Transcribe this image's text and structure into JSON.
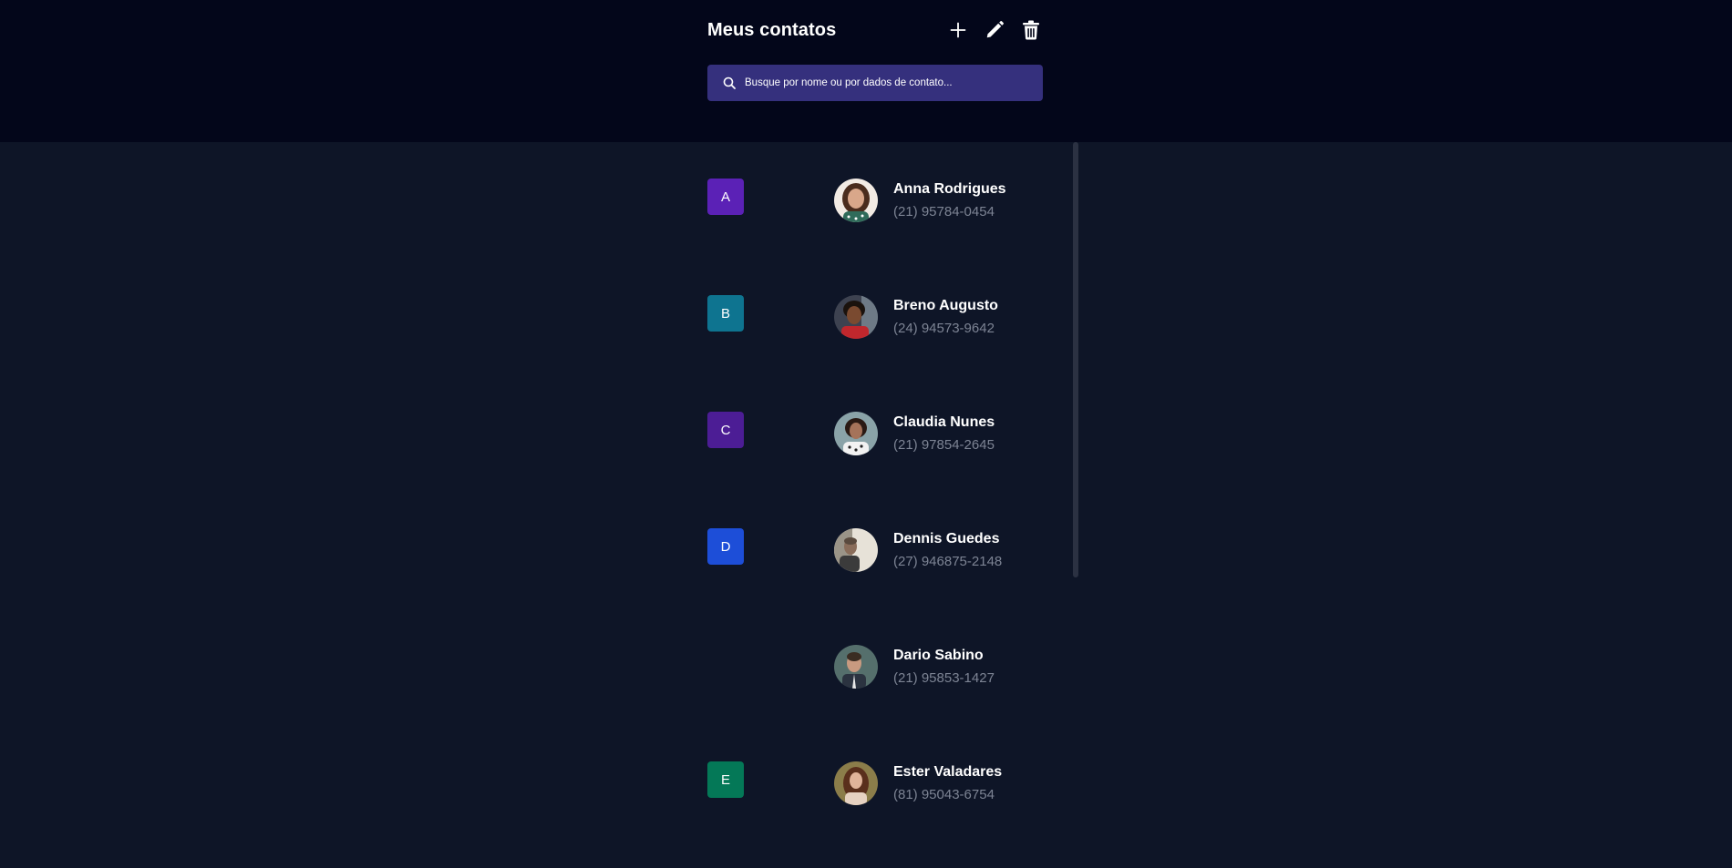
{
  "header": {
    "title": "Meus contatos",
    "actions": [
      {
        "name": "add",
        "icon": "plus-icon"
      },
      {
        "name": "edit",
        "icon": "pencil-icon"
      },
      {
        "name": "delete",
        "icon": "trash-icon"
      }
    ]
  },
  "search": {
    "placeholder": "Busque por nome ou por dados de contato...",
    "icon": "search-icon"
  },
  "groups": [
    {
      "letter": "A",
      "color": "#5b21b6",
      "contacts": [
        {
          "name": "Anna Rodrigues",
          "phone": "(21) 95784-0454"
        }
      ]
    },
    {
      "letter": "B",
      "color": "#0e7490",
      "contacts": [
        {
          "name": "Breno Augusto",
          "phone": "(24) 94573-9642"
        }
      ]
    },
    {
      "letter": "C",
      "color": "#4c1d95",
      "contacts": [
        {
          "name": "Claudia Nunes",
          "phone": "(21) 97854-2645"
        }
      ]
    },
    {
      "letter": "D",
      "color": "#1d4ed8",
      "contacts": [
        {
          "name": "Dennis Guedes",
          "phone": "(27) 946875-2148"
        },
        {
          "name": "Dario Sabino",
          "phone": "(21) 95853-1427"
        }
      ]
    },
    {
      "letter": "E",
      "color": "#047857",
      "contacts": [
        {
          "name": "Ester Valadares",
          "phone": "(81) 95043-6754"
        }
      ]
    }
  ],
  "colors": {
    "header_bg": "#03061a",
    "page_bg": "#0e1527",
    "search_bg": "#35307d",
    "phone_text": "#7d8494"
  }
}
